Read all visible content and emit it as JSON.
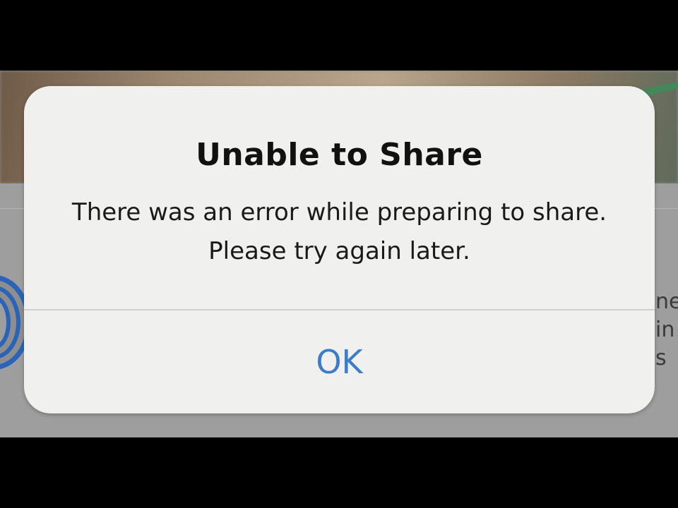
{
  "alert": {
    "title": "Unable to Share",
    "message": "There was an error while preparing to share. Please try again later.",
    "button_label": "OK"
  },
  "background": {
    "peek_text_lines": [
      "ne",
      "in",
      "s"
    ]
  },
  "colors": {
    "button_text": "#3d7cc9",
    "alert_background": "#f0f0ef",
    "title_text": "#111111"
  }
}
